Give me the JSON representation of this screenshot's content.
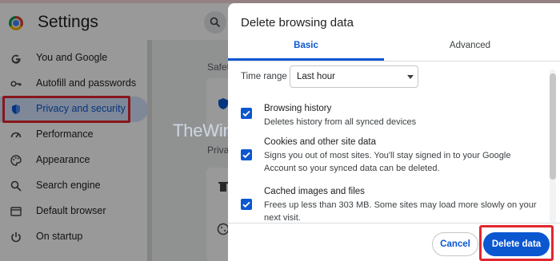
{
  "settings": {
    "title": "Settings",
    "sidebar": {
      "items": [
        {
          "label": "You and Google",
          "icon": "google-g-icon"
        },
        {
          "label": "Autofill and passwords",
          "icon": "key-icon"
        },
        {
          "label": "Privacy and security",
          "icon": "shield-icon",
          "active": true
        },
        {
          "label": "Performance",
          "icon": "speedometer-icon"
        },
        {
          "label": "Appearance",
          "icon": "palette-icon"
        },
        {
          "label": "Search engine",
          "icon": "search-icon"
        },
        {
          "label": "Default browser",
          "icon": "browser-window-icon"
        },
        {
          "label": "On startup",
          "icon": "power-icon"
        }
      ]
    },
    "content": {
      "safety_heading": "Safet",
      "privacy_heading": "Priva"
    }
  },
  "watermark": "TheWindowsClub.com",
  "dialog": {
    "title": "Delete browsing data",
    "tabs": {
      "basic": "Basic",
      "advanced": "Advanced",
      "selected": "basic"
    },
    "time_range": {
      "label": "Time range",
      "value": "Last hour"
    },
    "options": [
      {
        "title": "Browsing history",
        "description": "Deletes history from all synced devices",
        "checked": true
      },
      {
        "title": "Cookies and other site data",
        "description": "Signs you out of most sites. You'll stay signed in to your Google Account so your synced data can be deleted.",
        "checked": true
      },
      {
        "title": "Cached images and files",
        "description": "Frees up less than 303 MB. Some sites may load more slowly on your next visit.",
        "checked": true
      }
    ],
    "buttons": {
      "cancel": "Cancel",
      "delete": "Delete data"
    }
  },
  "colors": {
    "accent": "#0b57d0",
    "highlight_box": "#e3262e",
    "active_nav_bg": "#d3e3fd"
  }
}
